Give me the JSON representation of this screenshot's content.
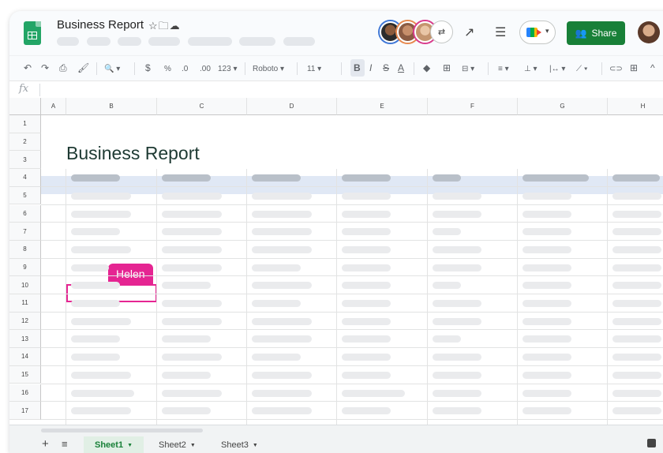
{
  "document": {
    "title": "Business Report",
    "title_icons": "☆🗀☁"
  },
  "header": {
    "more_collaborators_icon": "people-more",
    "activity_icon": "↗",
    "comments_icon": "☰",
    "share_label": "Share",
    "share_icon": "👥"
  },
  "toolbar": {
    "undo": "↶",
    "redo": "↷",
    "print": "⎙",
    "paint_format": "🖌",
    "zoom": "🔍 ▾",
    "currency": "$",
    "percent": "%",
    "decrease_decimal": ".0",
    "increase_decimal": ".00",
    "number_format": "123 ▾",
    "font": "Roboto ▾",
    "font_size": "11 ▾",
    "bold": "B",
    "italic": "I",
    "strikethrough": "S",
    "text_color": "A",
    "fill_color": "◆",
    "borders": "⊞",
    "merge": "⊟ ▾",
    "h_align": "≡ ▾",
    "v_align": "⊥ ▾",
    "wrap": "|↔ ▾",
    "rotate": "⟋ ▾",
    "link": "⊂⊃",
    "comment": "⊞",
    "collapse": "^"
  },
  "formula_bar": {
    "label": "fx"
  },
  "grid": {
    "columns": [
      "A",
      "B",
      "C",
      "D",
      "E",
      "F",
      "G",
      "H"
    ],
    "rows": [
      "1",
      "2",
      "3",
      "4",
      "5",
      "6",
      "7",
      "8",
      "9",
      "10",
      "11",
      "12",
      "13",
      "14",
      "15",
      "16",
      "17"
    ],
    "report_title": "Business Report",
    "collaborator_cursor": {
      "name": "Helen",
      "cell": "B10",
      "color": "#e52592"
    }
  },
  "sheets": {
    "tabs": [
      {
        "label": "Sheet1",
        "active": true
      },
      {
        "label": "Sheet2",
        "active": false
      },
      {
        "label": "Sheet3",
        "active": false
      }
    ],
    "add_icon": "+",
    "all_sheets_icon": "≡"
  },
  "colors": {
    "accent_green": "#188038",
    "collaborator_pink": "#e52592",
    "header_band": "#e0e8f5"
  }
}
